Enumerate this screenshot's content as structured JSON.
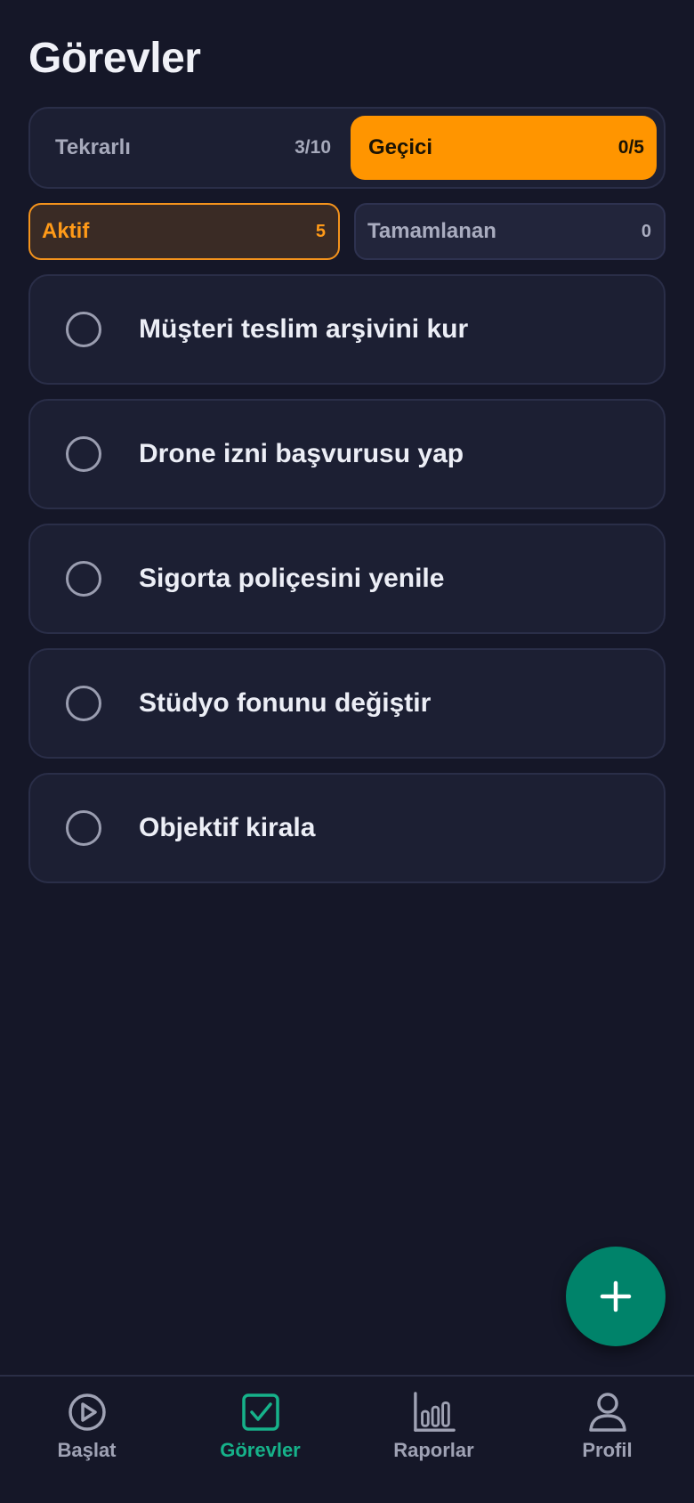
{
  "header": {
    "title": "Görevler"
  },
  "segments": [
    {
      "label": "Tekrarlı",
      "count": "3/10",
      "active": false
    },
    {
      "label": "Geçici",
      "count": "0/5",
      "active": true
    }
  ],
  "filters": [
    {
      "label": "Aktif",
      "count": "5",
      "active": true
    },
    {
      "label": "Tamamlanan",
      "count": "0",
      "active": false
    }
  ],
  "tasks": [
    {
      "title": "Müşteri teslim arşivini kur",
      "done": false
    },
    {
      "title": "Drone izni başvurusu yap",
      "done": false
    },
    {
      "title": "Sigorta poliçesini yenile",
      "done": false
    },
    {
      "title": "Stüdyo fonunu değiştir",
      "done": false
    },
    {
      "title": "Objektif kirala",
      "done": false
    }
  ],
  "fab": {
    "icon": "plus-icon"
  },
  "tabbar": {
    "items": [
      {
        "label": "Başlat",
        "icon": "play-circle-icon",
        "active": false
      },
      {
        "label": "Görevler",
        "icon": "checkbox-icon",
        "active": true
      },
      {
        "label": "Raporlar",
        "icon": "bar-chart-icon",
        "active": false
      },
      {
        "label": "Profil",
        "icon": "person-icon",
        "active": false
      }
    ]
  },
  "colors": {
    "background": "#151728",
    "accent_orange": "#ff9500",
    "accent_green": "#16b28a",
    "fab": "#00836a"
  }
}
